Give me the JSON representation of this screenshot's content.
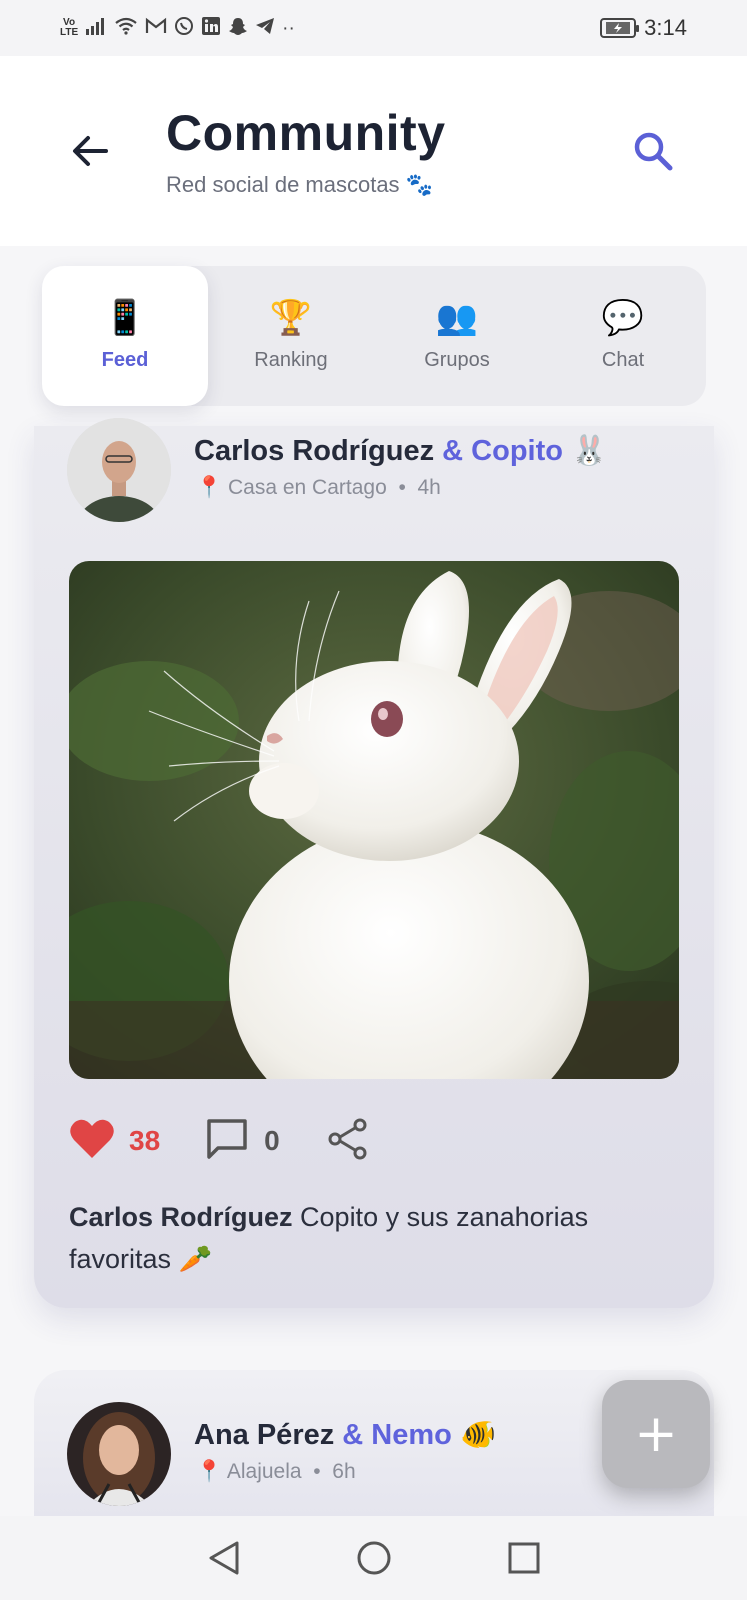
{
  "status_bar": {
    "volte_top": "Vo",
    "volte_bottom": "LTE",
    "icons": [
      "signal-icon",
      "wifi-icon",
      "gmail-icon",
      "whatsapp-icon",
      "linkedin-icon",
      "snapchat-icon",
      "telegram-icon"
    ],
    "more": "··",
    "time": "3:14"
  },
  "header": {
    "title": "Community",
    "subtitle": "Red social de mascotas 🐾"
  },
  "tabs": [
    {
      "label": "Feed",
      "icon": "📱",
      "active": true
    },
    {
      "label": "Ranking",
      "icon": "🏆",
      "active": false
    },
    {
      "label": "Grupos",
      "icon": "👥",
      "active": false
    },
    {
      "label": "Chat",
      "icon": "💬",
      "active": false
    }
  ],
  "posts": [
    {
      "user": "Carlos Rodríguez",
      "pet": "& Copito",
      "pet_emoji": "🐰",
      "location_icon": "📍",
      "location": "Casa en Cartago",
      "separator": "•",
      "time": "4h",
      "likes": "38",
      "comments": "0",
      "caption_user": "Carlos Rodríguez",
      "caption_text": " Copito y sus zanahorias favoritas 🥕"
    },
    {
      "user": "Ana Pérez",
      "pet": "& Nemo",
      "pet_emoji": "🐠",
      "location_icon": "📍",
      "location": "Alajuela",
      "separator": "•",
      "time": "6h"
    }
  ],
  "fab": {
    "label": "+"
  },
  "colors": {
    "accent": "#5b60d6",
    "like": "#e04545",
    "title": "#1d2333"
  }
}
